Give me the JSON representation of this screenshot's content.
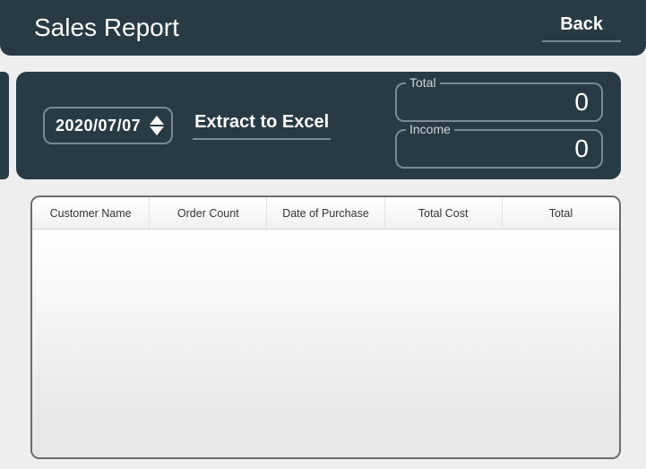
{
  "header": {
    "title": "Sales Report",
    "back_label": "Back"
  },
  "filters": {
    "date_value": "2020/07/07",
    "extract_label": "Extract to Excel"
  },
  "totals": {
    "total_label": "Total",
    "total_value": "0",
    "income_label": "Income",
    "income_value": "0"
  },
  "grid": {
    "columns": [
      "Customer Name",
      "Order Count",
      "Date of Purchase",
      "Total Cost",
      "Total"
    ],
    "rows": []
  }
}
